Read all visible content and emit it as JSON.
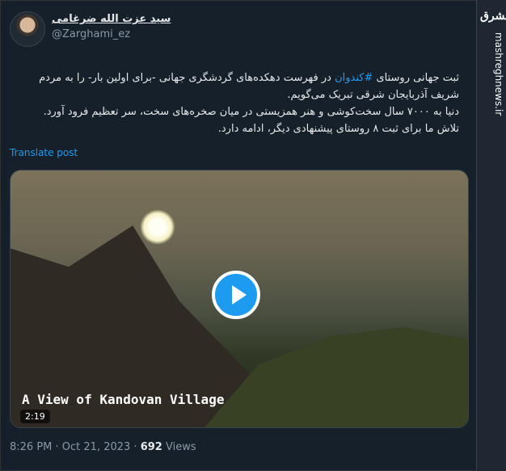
{
  "tweet": {
    "name": "سید عزت الله ضرغامی",
    "handle": "@Zarghami_ez",
    "body": {
      "line1_before": "ثبت جهانی روستای ",
      "hashtag": "#کندوان",
      "line1_after": " در فهرست دهکده‌های گردشگری جهانی -برای اولین بار- را به مردم",
      "line2": "شریف آذربایجان شرقی تبریک می‌گویم.",
      "line3": "دنیا به ۷۰۰۰ سال سخت‌کوشی و هنر همزیستی در میان صخره‌های سخت، سر تعظیم فرود آورد.",
      "line4": "تلاش ما برای ثبت ۸ روستای پیشنهادی دیگر، ادامه دارد."
    },
    "translate_label": "Translate post",
    "video": {
      "caption": "A View of Kandovan Village",
      "duration": "2:19"
    },
    "footer": {
      "time": "8:26 PM",
      "date": "Oct 21, 2023",
      "views_count": "692",
      "views_label": "Views"
    }
  },
  "watermark": {
    "logo": "مشرق",
    "url": "mashreghnews.ir"
  }
}
